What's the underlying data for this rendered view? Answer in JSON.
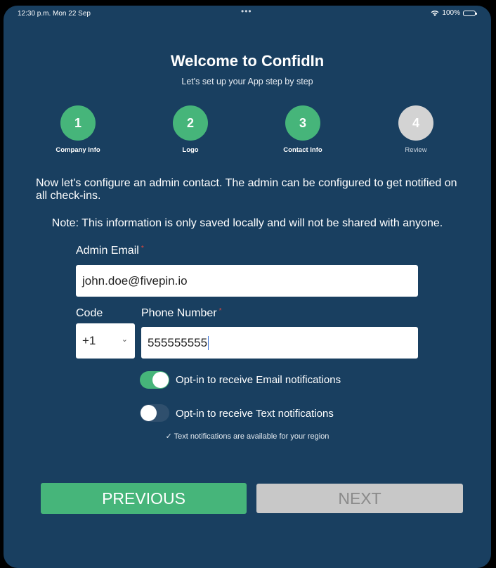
{
  "status": {
    "time": "12:30 p.m.  Mon 22 Sep",
    "dots": "•••",
    "battery": "100%"
  },
  "header": {
    "title": "Welcome to ConfidIn",
    "subtitle": "Let's set up your App step by step"
  },
  "steps": [
    {
      "number": "1",
      "label": "Company Info",
      "state": "done"
    },
    {
      "number": "2",
      "label": "Logo",
      "state": "done"
    },
    {
      "number": "3",
      "label": "Contact Info",
      "state": "done"
    },
    {
      "number": "4",
      "label": "Review",
      "state": "pending"
    }
  ],
  "content": {
    "intro": "Now let's configure an admin contact. The admin can be configured to get notified on all check-ins.",
    "note": "Note: This information is only saved locally and will not be shared with anyone."
  },
  "form": {
    "email_label": "Admin Email",
    "email_value": "john.doe@fivepin.io",
    "code_label": "Code",
    "code_value": "+1",
    "phone_label": "Phone Number",
    "phone_value": "555555555",
    "required_mark": "*"
  },
  "toggles": {
    "email_label": "Opt-in to receive Email notifications",
    "email_on": true,
    "text_label": "Opt-in to receive Text notifications",
    "text_on": false,
    "region_note": "✓ Text notifications are available for your region"
  },
  "buttons": {
    "previous": "PREVIOUS",
    "next": "NEXT"
  },
  "colors": {
    "background": "#193f60",
    "accent_green": "#46b57a",
    "pending_gray": "#d3d3d3",
    "required_red": "#e0473c"
  }
}
